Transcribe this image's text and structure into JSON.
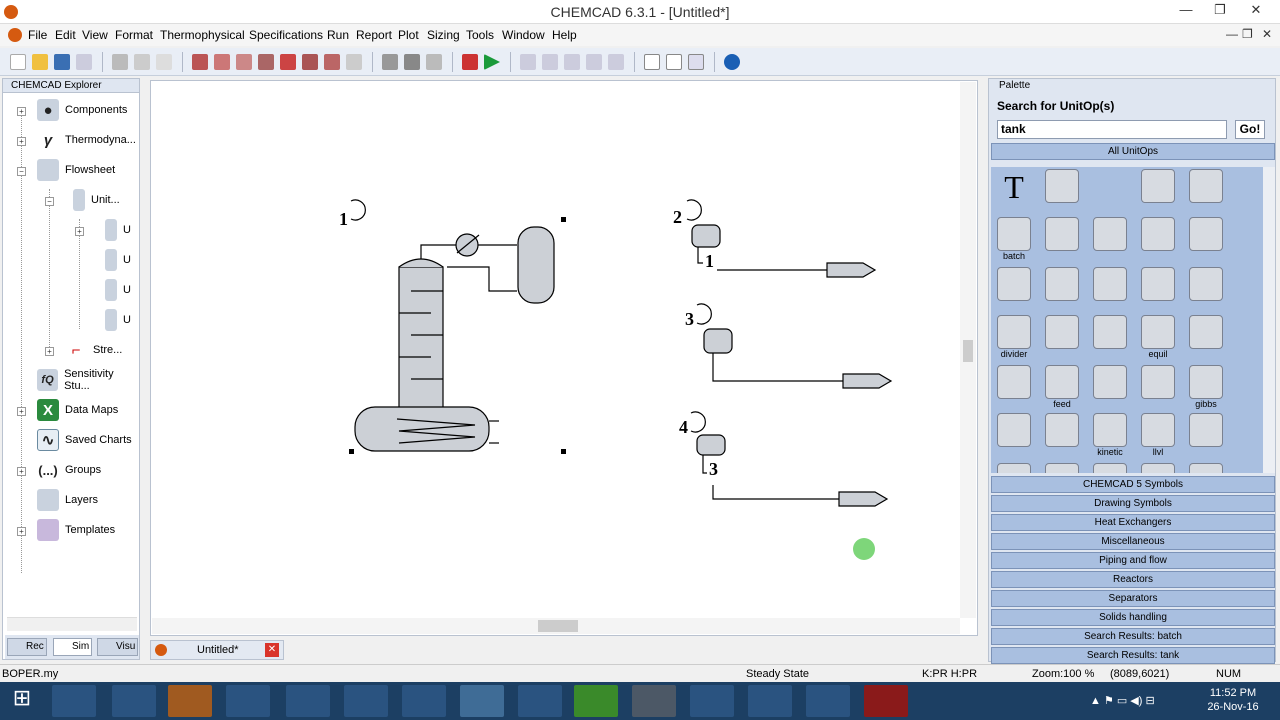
{
  "window": {
    "title": "CHEMCAD 6.3.1 - [Untitled*]",
    "controls": [
      "minimize",
      "maximize",
      "close"
    ]
  },
  "menu": [
    "File",
    "Edit",
    "View",
    "Format",
    "Thermophysical",
    "Specifications",
    "Run",
    "Report",
    "Plot",
    "Sizing",
    "Tools",
    "Window",
    "Help"
  ],
  "explorer": {
    "title": "CHEMCAD Explorer",
    "items": [
      {
        "label": "Components",
        "icon": "components-icon"
      },
      {
        "label": "Thermodyna...",
        "icon": "gamma-icon"
      },
      {
        "label": "Flowsheet",
        "icon": "flowsheet-icon"
      },
      {
        "label": "Unit...",
        "icon": "column-icon"
      },
      {
        "label": "U",
        "icon": "column-icon"
      },
      {
        "label": "U",
        "icon": "column-icon"
      },
      {
        "label": "U",
        "icon": "column-icon"
      },
      {
        "label": "U",
        "icon": "column-icon"
      },
      {
        "label": "Stre...",
        "icon": "stream-icon"
      },
      {
        "label": "Sensitivity Stu...",
        "icon": "sensitivity-icon"
      },
      {
        "label": "Data Maps",
        "icon": "excel-icon"
      },
      {
        "label": "Saved Charts",
        "icon": "chart-icon"
      },
      {
        "label": "Groups",
        "icon": "groups-icon"
      },
      {
        "label": "Layers",
        "icon": "layers-icon"
      },
      {
        "label": "Templates",
        "icon": "templates-icon"
      }
    ],
    "tabs": [
      "Rec",
      "Sim",
      "Visu"
    ]
  },
  "flowsheet": {
    "units": [
      {
        "id": "1",
        "label": "1",
        "type": "distillation-column"
      },
      {
        "id": "2",
        "label": "2",
        "stream": "1"
      },
      {
        "id": "3",
        "label": "3",
        "stream": ""
      },
      {
        "id": "4",
        "label": "4",
        "stream": "3"
      }
    ]
  },
  "doc_tab": "Untitled*",
  "palette": {
    "title": "Palette",
    "search_title": "Search for UnitOp(s)",
    "search_value": "tank",
    "go_label": "Go!",
    "all_unitops": "All UnitOps",
    "icon_labels": {
      "batch": "batch",
      "divider": "divider",
      "equil": "equil",
      "feed": "feed",
      "gibbs": "gibbs",
      "kinetic": "kinetic",
      "llvl": "llvl"
    },
    "categories": [
      "CHEMCAD 5 Symbols",
      "Drawing Symbols",
      "Heat Exchangers",
      "Miscellaneous",
      "Piping and flow",
      "Reactors",
      "Separators",
      "Solids handling"
    ],
    "search_results": [
      "Search Results:  batch",
      "Search Results:  tank"
    ]
  },
  "status": {
    "left": "BOPER.my",
    "mode": "Steady State",
    "kpr": "K:PR H:PR",
    "zoom": "Zoom:100 %",
    "coords": "(8089,6021)",
    "num": "NUM"
  },
  "taskbar": {
    "time": "11:52 PM",
    "date": "26-Nov-16"
  }
}
